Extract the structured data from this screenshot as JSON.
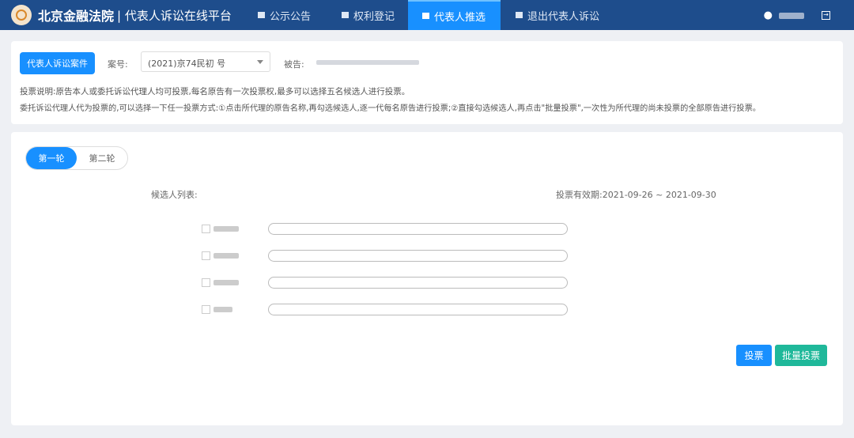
{
  "header": {
    "court": "北京金融法院",
    "platform": "| 代表人诉讼在线平台",
    "tabs": [
      {
        "label": "公示公告"
      },
      {
        "label": "权利登记"
      },
      {
        "label": "代表人推选",
        "active": true
      },
      {
        "label": "退出代表人诉讼"
      }
    ]
  },
  "case": {
    "tag": "代表人诉讼案件",
    "case_no_label": "案号:",
    "case_no_value": "(2021)京74民初  号",
    "defendant_label": "被告:",
    "note1": "投票说明:原告本人或委托诉讼代理人均可投票,每名原告有一次投票权,最多可以选择五名候选人进行投票。",
    "note2": "委托诉讼代理人代为投票的,可以选择一下任一投票方式:①点击所代理的原告名称,再勾选候选人,逐一代每名原告进行投票;②直接勾选候选人,再点击\"批量投票\",一次性为所代理的尚未投票的全部原告进行投票。"
  },
  "vote": {
    "rounds": [
      "第一轮",
      "第二轮"
    ],
    "candidates_label": "候选人列表:",
    "period": "投票有效期:2021-09-26 ~ 2021-09-30",
    "vote_btn": "投票",
    "batch_btn": "批量投票"
  },
  "colors": {
    "nav": "#1e4d8c",
    "accent": "#1890ff",
    "batch": "#1fb89a"
  }
}
